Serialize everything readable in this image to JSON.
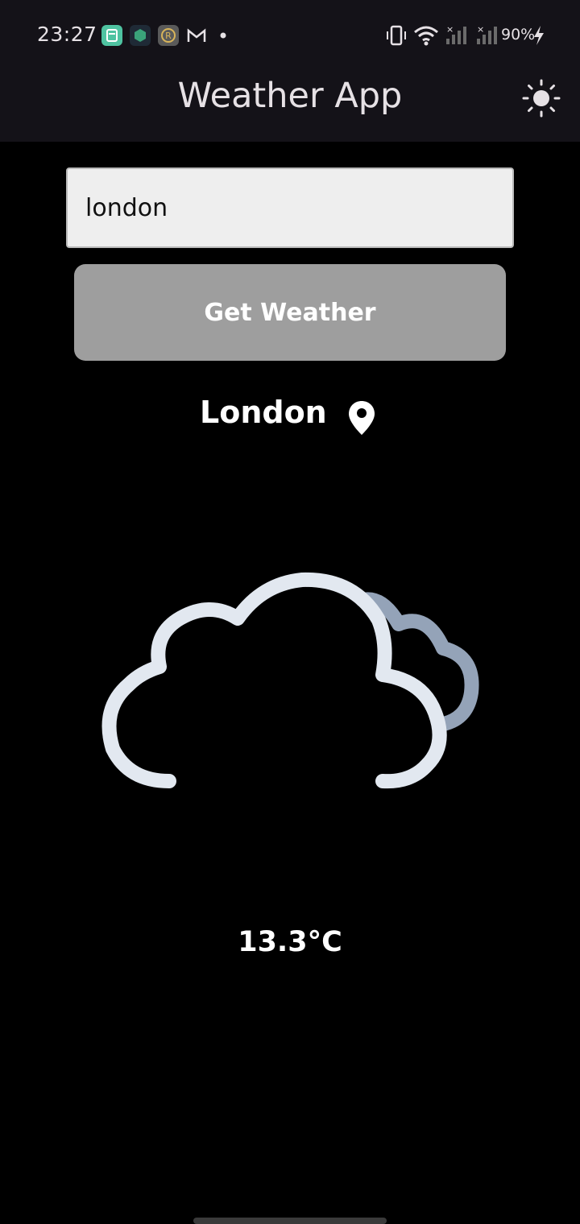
{
  "status_bar": {
    "time": "23:27",
    "battery_percent": "90%",
    "notification_icons": [
      "calendar-app-icon",
      "cube-app-icon",
      "r-app-icon",
      "gmail-icon",
      "dot-icon"
    ],
    "system_icons": [
      "vibrate-icon",
      "wifi-icon",
      "signal-icon",
      "signal-icon",
      "battery-charging-icon"
    ]
  },
  "app_bar": {
    "title": "Weather App",
    "theme_toggle_icon": "sun-icon"
  },
  "search": {
    "value": "london",
    "placeholder": ""
  },
  "actions": {
    "get_weather_label": "Get Weather"
  },
  "result": {
    "city": "London",
    "location_icon": "location-pin-icon",
    "condition_icon": "cloudy-icon",
    "temperature": "13.3°C"
  },
  "colors": {
    "app_bar_bg": "#141218",
    "background": "#000000",
    "input_bg": "#eeeeee",
    "button_bg": "#9e9e9e",
    "cloud_front": "#e2e8f0",
    "cloud_back": "#94a3b8"
  }
}
